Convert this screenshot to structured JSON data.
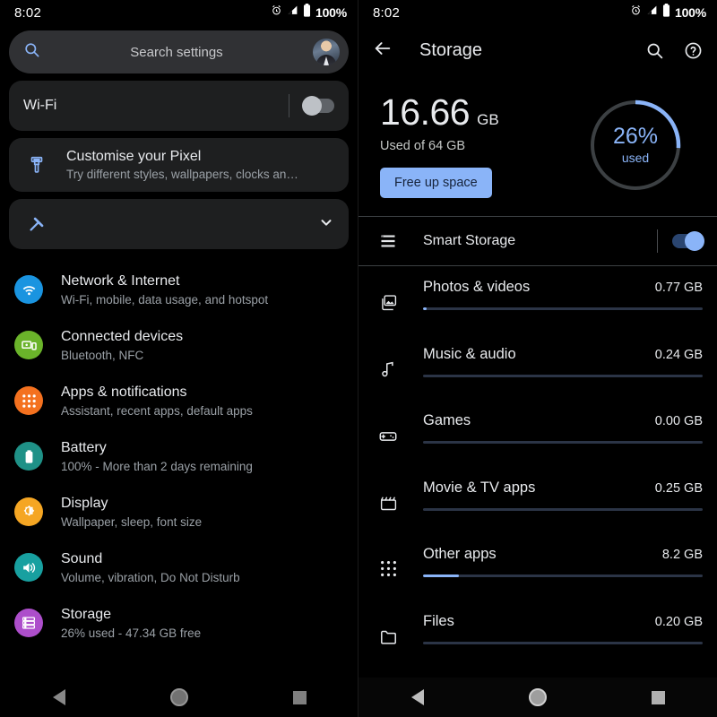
{
  "status_bar": {
    "time": "8:02",
    "battery_percent": "100%",
    "icons": [
      "alarm-icon",
      "signal-icon",
      "battery-icon"
    ]
  },
  "left_panel": {
    "search": {
      "placeholder": "Search settings",
      "icon": "search-icon",
      "avatar": "user-avatar"
    },
    "wifi_card": {
      "title": "Wi-Fi",
      "toggle_state": "off"
    },
    "pixel_card": {
      "icon": "paint-brush-icon",
      "title": "Customise your Pixel",
      "subtitle": "Try different styles, wallpapers, clocks an…"
    },
    "collapsed_card": {
      "icon": "cable-icon",
      "title": "",
      "chevron": "chevron-down-icon"
    },
    "settings": [
      {
        "icon": "wifi-icon",
        "color": "#1a94e0",
        "title": "Network & Internet",
        "subtitle": "Wi-Fi, mobile, data usage, and hotspot"
      },
      {
        "icon": "connected-devices-icon",
        "color": "#6ab32a",
        "title": "Connected devices",
        "subtitle": "Bluetooth, NFC"
      },
      {
        "icon": "apps-grid-icon",
        "color": "#f4711f",
        "title": "Apps & notifications",
        "subtitle": "Assistant, recent apps, default apps"
      },
      {
        "icon": "battery-icon",
        "color": "#1f9187",
        "title": "Battery",
        "subtitle": "100% - More than 2 days remaining"
      },
      {
        "icon": "brightness-icon",
        "color": "#f5a623",
        "title": "Display",
        "subtitle": "Wallpaper, sleep, font size"
      },
      {
        "icon": "speaker-icon",
        "color": "#18a0a0",
        "title": "Sound",
        "subtitle": "Volume, vibration, Do Not Disturb"
      },
      {
        "icon": "storage-icon",
        "color": "#ad4ecb",
        "title": "Storage",
        "subtitle": "26% used - 47.34 GB free"
      }
    ],
    "nav_bar": {
      "back": "back-icon",
      "home": "home-icon",
      "recents": "recents-icon"
    }
  },
  "right_panel": {
    "app_bar": {
      "back_icon": "arrow-back-icon",
      "title": "Storage",
      "search_icon": "search-icon",
      "help_icon": "help-icon"
    },
    "summary": {
      "used_value": "16.66",
      "used_unit": "GB",
      "used_of": "Used of 64 GB",
      "free_up_button": "Free up space",
      "donut_percent": "26%",
      "donut_label": "used",
      "donut_value": 26,
      "accent_color": "#8ab4f8",
      "track_color": "#3c4043"
    },
    "smart_storage": {
      "icon": "storage-list-icon",
      "title": "Smart Storage",
      "toggle_state": "on"
    },
    "categories": [
      {
        "icon": "photo-library-icon",
        "name": "Photos & videos",
        "size": "0.77 GB",
        "bar_percent": 1.4
      },
      {
        "icon": "music-note-icon",
        "name": "Music & audio",
        "size": "0.24 GB",
        "bar_percent": 0
      },
      {
        "icon": "gamepad-icon",
        "name": "Games",
        "size": "0.00 GB",
        "bar_percent": 0
      },
      {
        "icon": "movie-clapper-icon",
        "name": "Movie & TV apps",
        "size": "0.25 GB",
        "bar_percent": 0
      },
      {
        "icon": "app-grid-icon",
        "name": "Other apps",
        "size": "8.2 GB",
        "bar_percent": 12.8
      },
      {
        "icon": "folder-icon",
        "name": "Files",
        "size": "0.20 GB",
        "bar_percent": 0
      }
    ],
    "nav_bar": {
      "back": "back-icon",
      "home": "home-icon",
      "recents": "recents-icon"
    }
  }
}
